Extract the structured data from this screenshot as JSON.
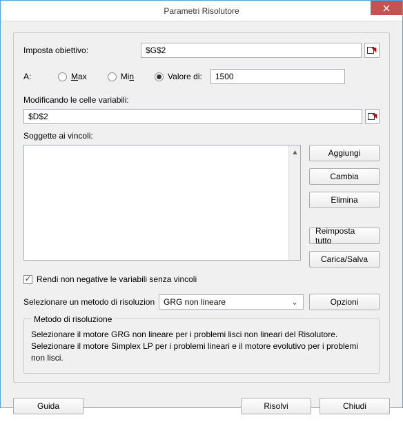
{
  "window": {
    "title": "Parametri Risolutore"
  },
  "labels": {
    "imposta_obiettivo": "Imposta obiettivo:",
    "a": "A:",
    "max": "Max",
    "min": "Min",
    "valore_di": "Valore di:",
    "modificando": "Modificando le celle variabili:",
    "soggette": "Soggette ai vincoli:",
    "rendi_nonneg": "Rendi non negative le variabili senza vincoli",
    "selez_metodo": "Selezionare un metodo di risoluzion",
    "metodo_box_title": "Metodo di risoluzione",
    "metodo_desc": "Selezionare il motore GRG non lineare per i problemi lisci non lineari del Risolutore. Selezionare il motore Simplex LP per i problemi lineari e il motore evolutivo per i problemi non lisci."
  },
  "buttons": {
    "aggiungi": "Aggiungi",
    "cambia": "Cambia",
    "elimina": "Elimina",
    "reimposta": "Reimposta tutto",
    "carica_salva": "Carica/Salva",
    "opzioni": "Opzioni",
    "guida": "Guida",
    "risolvi": "Risolvi",
    "chiudi": "Chiudi"
  },
  "values": {
    "obiettivo": "$G$2",
    "valore_di": "1500",
    "celle_variabili": "$D$2",
    "metodo_selected": "GRG non lineare",
    "radio_selected": "valore_di",
    "nonneg_checked": true
  },
  "constraints": []
}
